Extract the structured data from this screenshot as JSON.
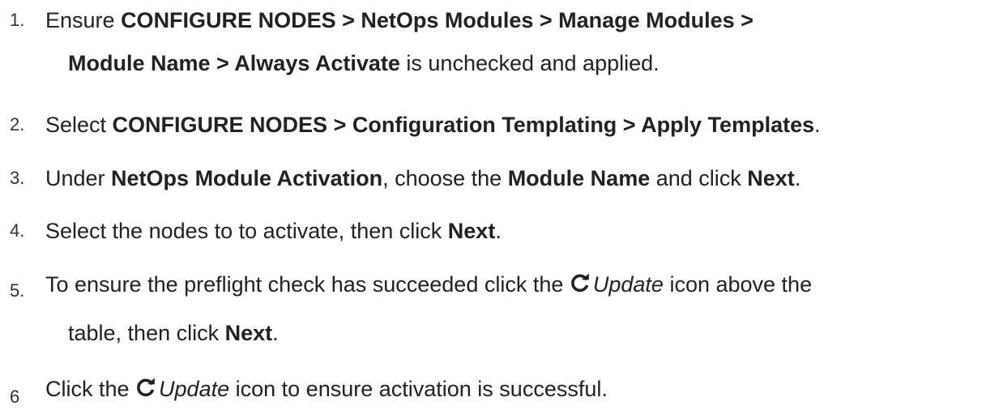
{
  "steps": [
    {
      "num": "1.",
      "line1": [
        {
          "t": "Ensure ",
          "b": false
        },
        {
          "t": "CONFIGURE NODES > NetOps Modules > Manage Modules >",
          "b": true
        }
      ],
      "line2": [
        {
          "t": "Module Name > Always Activate",
          "b": true
        },
        {
          "t": " is unchecked and applied.",
          "b": false
        }
      ]
    },
    {
      "num": "2.",
      "line1": [
        {
          "t": "Select ",
          "b": false
        },
        {
          "t": "CONFIGURE NODES > Configuration Templating > Apply Templates",
          "b": true
        },
        {
          "t": ".",
          "b": false
        }
      ]
    },
    {
      "num": "3.",
      "line1": [
        {
          "t": "Under ",
          "b": false
        },
        {
          "t": "NetOps Module Activation",
          "b": true
        },
        {
          "t": ", choose the ",
          "b": false
        },
        {
          "t": "Module Name",
          "b": true
        },
        {
          "t": " and click ",
          "b": false
        },
        {
          "t": "Next",
          "b": true
        },
        {
          "t": ".",
          "b": false
        }
      ]
    },
    {
      "num": "4.",
      "line1": [
        {
          "t": "Select the nodes to to activate, then click ",
          "b": false
        },
        {
          "t": "Next",
          "b": true
        },
        {
          "t": ".",
          "b": false
        }
      ]
    },
    {
      "num": "5.",
      "line1_pre": "To ensure the preflight check has succeeded click the ",
      "update_label": "Update",
      "line1_post": " icon above the",
      "line2": [
        {
          "t": "table, then click ",
          "b": false
        },
        {
          "t": "Next",
          "b": true
        },
        {
          "t": ".",
          "b": false
        }
      ]
    },
    {
      "num": "6",
      "line1_pre": "Click the ",
      "update_label": "Update",
      "line1_post": " icon to ensure activation is successful."
    }
  ],
  "icon": "refresh-icon"
}
